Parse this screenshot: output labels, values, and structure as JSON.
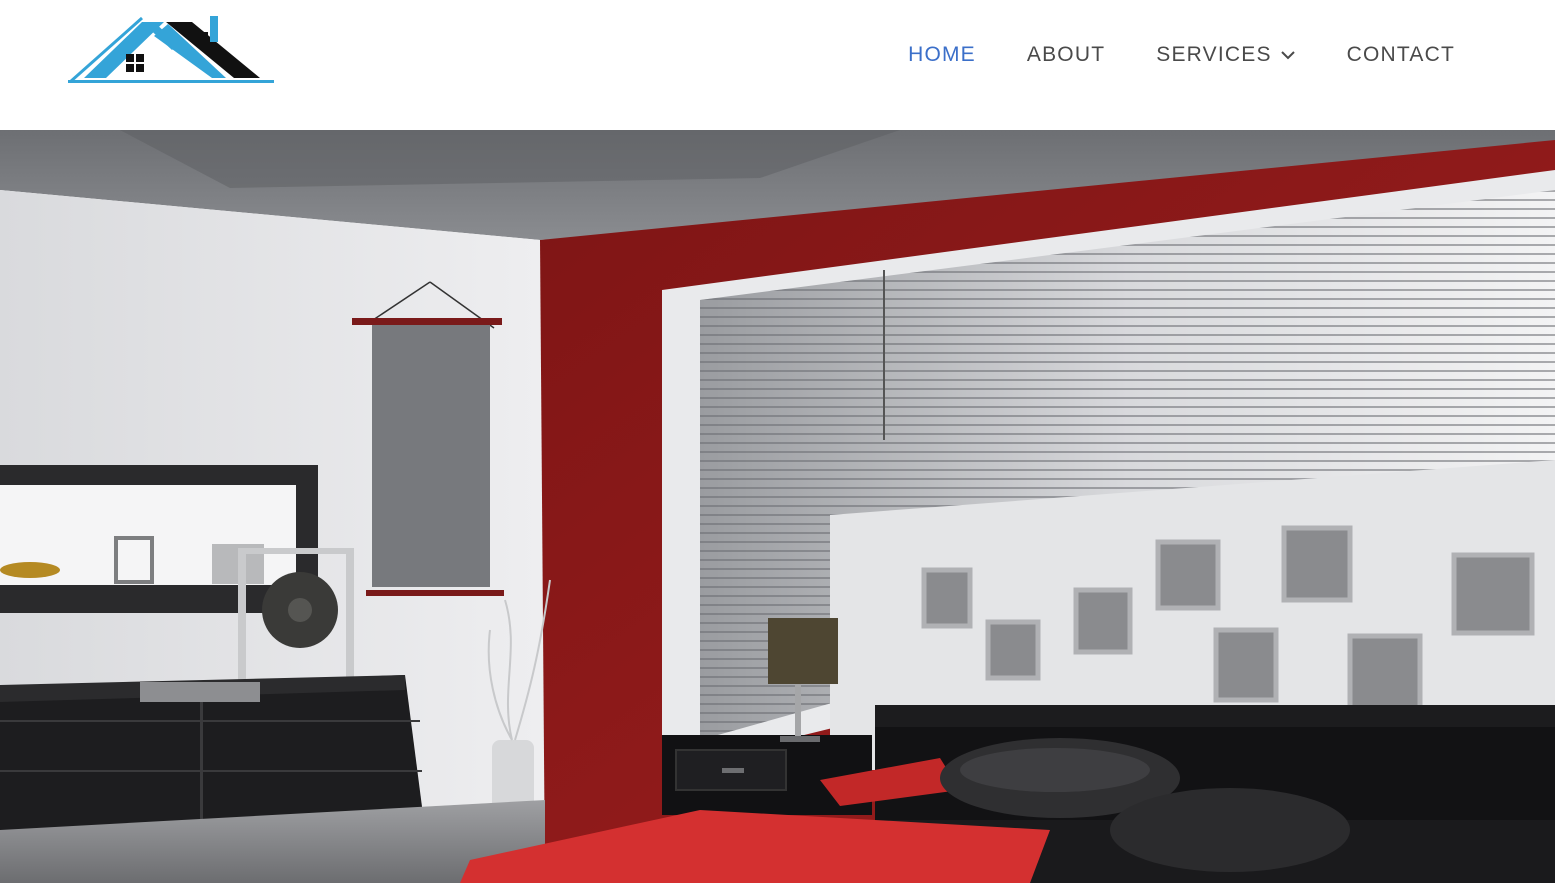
{
  "header": {
    "logo": {
      "icon": "house-roof-logo-icon",
      "colors": {
        "blue": "#34a4d8",
        "black": "#111111"
      }
    },
    "nav": {
      "active_color": "#3b6fc9",
      "text_color": "#4a4a4a",
      "items": [
        {
          "label": "HOME",
          "active": true
        },
        {
          "label": "ABOUT",
          "active": false
        },
        {
          "label": "SERVICES",
          "active": false,
          "icon": "chevron-down-icon"
        },
        {
          "label": "CONTACT",
          "active": false
        }
      ]
    }
  },
  "hero": {
    "image": "bedroom-interior-illustration",
    "accent_colors": {
      "red_wall": "#8c1a1a",
      "bedding_red": "#d43030",
      "furniture_black": "#1e1e1e",
      "wall_white": "#e6e6e8"
    }
  }
}
